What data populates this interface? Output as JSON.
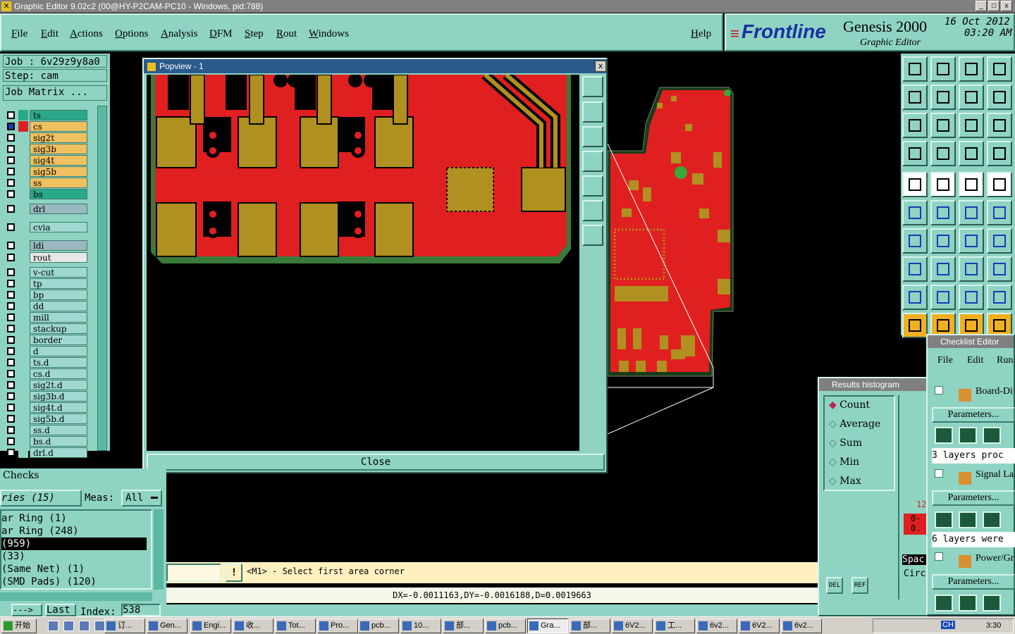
{
  "window": {
    "title": "Graphic Editor 9.02c2 (00@HY-P2CAM-PC10 - Windows, pid:788)",
    "min": "_",
    "max": "□",
    "close": "x"
  },
  "menu": {
    "items": [
      "File",
      "Edit",
      "Actions",
      "Options",
      "Analysis",
      "DFM",
      "Step",
      "Rout",
      "Windows"
    ],
    "help": "Help"
  },
  "brand": {
    "logo": "Frontline",
    "product": "Genesis 2000",
    "subtitle": "Graphic Editor",
    "date": "16 Oct 2012",
    "time": "03:20 AM"
  },
  "job": {
    "job": "Job : 6v29z9y8a0",
    "step": "Step: cam",
    "matrix_btn": "Job Matrix ..."
  },
  "layers": [
    {
      "name": "ts",
      "color": "#2aa88a",
      "swatch": "#2aa88a"
    },
    {
      "name": "cs",
      "color": "#f0c060",
      "swatch": "#e02020",
      "selected": true
    },
    {
      "name": "sig2t",
      "color": "#f0c060",
      "swatch": "#8fd3c3"
    },
    {
      "name": "sig3b",
      "color": "#f0c060",
      "swatch": "#8fd3c3"
    },
    {
      "name": "sig4t",
      "color": "#f0c060",
      "swatch": "#8fd3c3"
    },
    {
      "name": "sig5b",
      "color": "#f0c060",
      "swatch": "#8fd3c3"
    },
    {
      "name": "ss",
      "color": "#f0c060",
      "swatch": "#8fd3c3"
    },
    {
      "name": "bs",
      "color": "#2aa88a",
      "swatch": "#8fd3c3"
    },
    {
      "name": "drl",
      "color": "#9ab8c0",
      "swatch": "#8fd3c3"
    },
    {
      "name": "cvia",
      "color": "#9ed8d0",
      "swatch": "#8fd3c3"
    },
    {
      "name": "ldi",
      "color": "#9ab8c0",
      "swatch": "#8fd3c3"
    },
    {
      "name": "rout",
      "color": "#e8e8e8",
      "swatch": "#8fd3c3"
    },
    {
      "name": "v-cut",
      "color": "#9ed8d0",
      "swatch": "#8fd3c3"
    },
    {
      "name": "tp",
      "color": "#9ed8d0",
      "swatch": "#8fd3c3"
    },
    {
      "name": "bp",
      "color": "#9ed8d0",
      "swatch": "#8fd3c3"
    },
    {
      "name": "dd",
      "color": "#9ed8d0",
      "swatch": "#8fd3c3"
    },
    {
      "name": "mill",
      "color": "#9ed8d0",
      "swatch": "#8fd3c3"
    },
    {
      "name": "stackup",
      "color": "#9ed8d0",
      "swatch": "#8fd3c3"
    },
    {
      "name": "border",
      "color": "#9ed8d0",
      "swatch": "#8fd3c3"
    },
    {
      "name": "d",
      "color": "#9ed8d0",
      "swatch": "#8fd3c3"
    },
    {
      "name": "ts.d",
      "color": "#9ed8d0",
      "swatch": "#8fd3c3"
    },
    {
      "name": "cs.d",
      "color": "#9ed8d0",
      "swatch": "#8fd3c3"
    },
    {
      "name": "sig2t.d",
      "color": "#9ed8d0",
      "swatch": "#8fd3c3"
    },
    {
      "name": "sig3b.d",
      "color": "#9ed8d0",
      "swatch": "#8fd3c3"
    },
    {
      "name": "sig4t.d",
      "color": "#9ed8d0",
      "swatch": "#8fd3c3"
    },
    {
      "name": "sig5b.d",
      "color": "#9ed8d0",
      "swatch": "#8fd3c3"
    },
    {
      "name": "ss.d",
      "color": "#9ed8d0",
      "swatch": "#8fd3c3"
    },
    {
      "name": "bs.d",
      "color": "#9ed8d0",
      "swatch": "#8fd3c3"
    },
    {
      "name": "drl.d",
      "color": "#9ed8d0",
      "swatch": "#8fd3c3"
    }
  ],
  "popview": {
    "title": "Popview - 1",
    "close_btn": "Close",
    "close_x": "x"
  },
  "checks": {
    "title": "Checks",
    "categories": "ries (15)",
    "meas_label": "Meas:",
    "meas_value": "All",
    "items": [
      "ar Ring (1)",
      "ar Ring (248)",
      "(959)",
      " (33)",
      " (Same Net) (1)",
      " (SMD Pads) (120)"
    ],
    "arrow_btn": "--->",
    "last_btn": "Last",
    "index_label": "Index:",
    "index_value": "538"
  },
  "status": {
    "prompt": "<M1> - Select first area corner",
    "warn": "!",
    "coords": "DX=-0.0011163,DY=-0.0016188,D=0.0019663"
  },
  "histogram": {
    "title": "Results histogram",
    "options": [
      "Count",
      "Average",
      "Sum",
      "Min",
      "Max"
    ],
    "selected": "Count",
    "del": "DEL",
    "ref": "REF",
    "bar_value": "12",
    "bar_label": "0-",
    "bar_label2": "0.",
    "spac": "Spac",
    "circ": "Circ"
  },
  "checklist": {
    "title": "Checklist Editor",
    "menu": [
      "File",
      "Edit",
      "Run"
    ],
    "entries": [
      {
        "name": "Board-Di",
        "params": "Parameters...",
        "summary": ""
      },
      {
        "name": "",
        "params": "",
        "summary": "3 layers proc"
      },
      {
        "name": "Signal La",
        "params": "Parameters...",
        "summary": "6 layers were"
      },
      {
        "name": "Power/Gr",
        "params": "Parameters...",
        "summary": ""
      }
    ]
  },
  "taskbar": {
    "start": "开始",
    "tasks": [
      "订...",
      "Gen...",
      "Engi...",
      "收...",
      "Tot...",
      "Pro...",
      "pcb...",
      "10...",
      "部...",
      "pcb...",
      "Gra...",
      "部...",
      "6V2...",
      "工...",
      "6v2...",
      "6V2...",
      "6v2..."
    ],
    "clock": "3:30",
    "ime": "CH"
  }
}
